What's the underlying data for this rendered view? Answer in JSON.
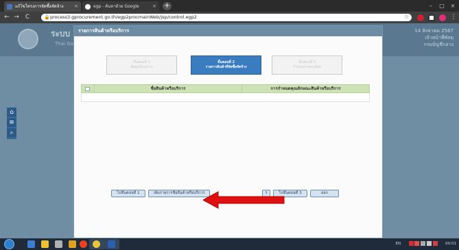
{
  "browser": {
    "tabs": [
      {
        "title": "แก้ไขโครงการจัดซื้อจัดจ้าง",
        "active": true,
        "icon_color": "#4a73b9"
      },
      {
        "title": "egp - ค้นหาด้วย Google",
        "active": false,
        "icon_color": "#ffffff"
      }
    ],
    "new_tab_label": "+",
    "address": {
      "url": "process3.gprocurement.go.th/egp2procmainWeb/jsp/control.egp2",
      "secure_icon": "lock-icon"
    },
    "nav": {
      "back": "←",
      "forward": "→",
      "reload": "C"
    }
  },
  "header": {
    "title": "ระบบ",
    "subtitle": "Thai Go",
    "right_line1": "14 สิงหาคม 2567",
    "right_line2": "เจ้าหน้าที่พัสดุ",
    "right_line3": "กรมบัญชีกลาง"
  },
  "sidebar": {
    "items": [
      {
        "icon": "home-icon",
        "glyph": "⌂"
      },
      {
        "icon": "menu-icon",
        "glyph": "≡"
      },
      {
        "icon": "search-icon",
        "glyph": "⌕"
      }
    ]
  },
  "modal": {
    "title": "รายการสินค้าหรือบริการ",
    "steps": [
      {
        "line1": "ขั้นตอนที่ 1",
        "line2": "ข้อมูลโครงการ",
        "active": false
      },
      {
        "line1": "ขั้นตอนที่ 2",
        "line2": "รายการสินค้าที่จัดซื้อจัดจ้าง",
        "active": true
      },
      {
        "line1": "ขั้นตอนที่ 3",
        "line2": "กำหนดรายละเอียด",
        "active": false
      }
    ],
    "table": {
      "columns": [
        "ชื่อสินค้าหรือบริการ",
        "การกำหนดคุณลักษณะสินค้าหรือบริการ"
      ]
    },
    "buttons": {
      "step1": "ไปขั้นตอนที่ 1",
      "add_item": "เพิ่มรายการชื่อสินค้าหรือบริการ",
      "partial": "ร",
      "step3": "ไปขั้นตอนที่ 3",
      "exit": "ออก"
    }
  },
  "annotation": {
    "color": "#e01010"
  },
  "taskbar": {
    "lang": "EN",
    "time": "00:01"
  }
}
